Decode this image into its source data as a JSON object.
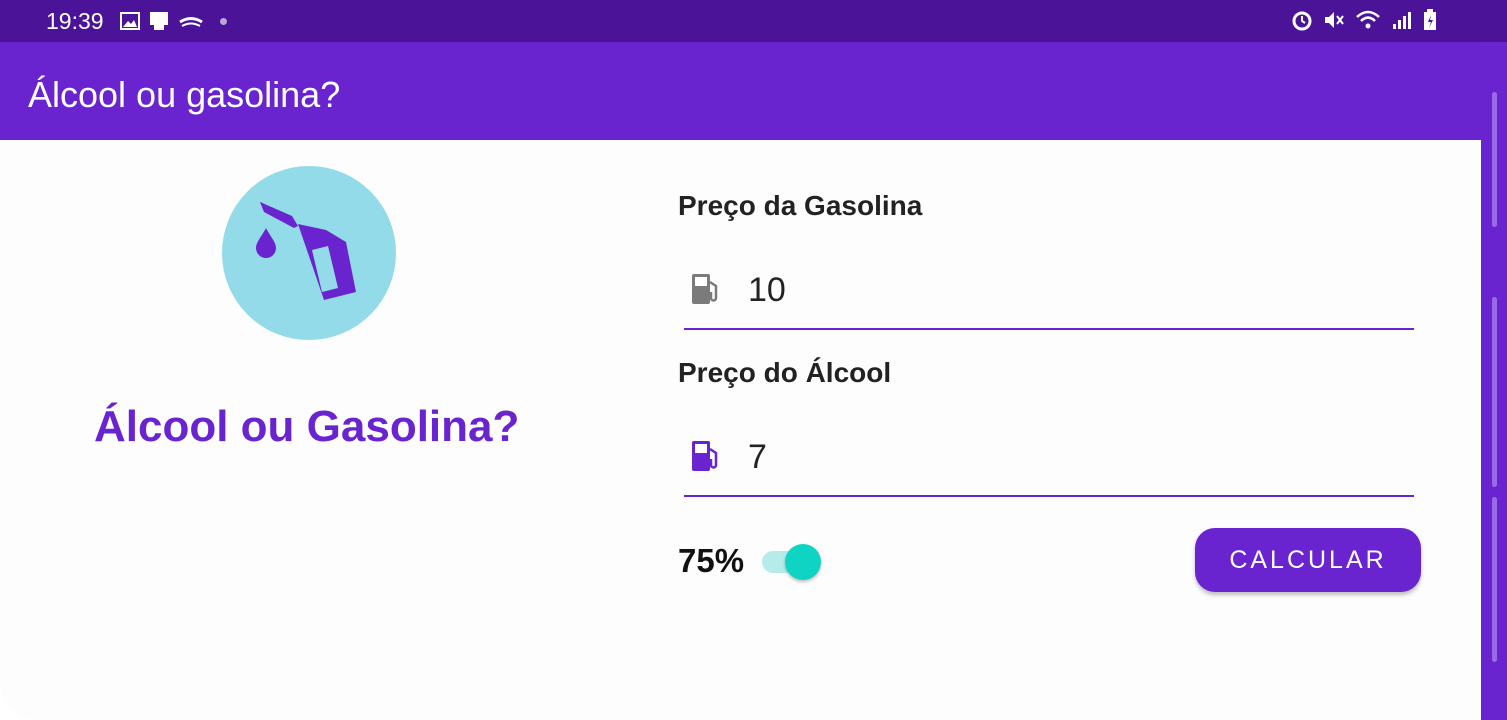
{
  "status_bar": {
    "time": "19:39",
    "left_icons": [
      "image-icon",
      "screen-cast-icon",
      "ifood-icon"
    ],
    "right_icons": [
      "alarm-icon",
      "mute-icon",
      "wifi-icon",
      "signal-icon",
      "battery-icon"
    ]
  },
  "app_bar": {
    "title": "Álcool ou gasolina?"
  },
  "hero": {
    "icon": "fuel-pump-icon",
    "title": "Álcool ou Gasolina?"
  },
  "form": {
    "gasolina": {
      "label": "Preço da Gasolina",
      "value": "10",
      "icon": "gas-station-icon"
    },
    "alcool": {
      "label": "Preço do Álcool",
      "value": "7",
      "icon": "gas-station-icon"
    },
    "percent_label": "75%",
    "switch_on": true,
    "calc_button": "CALCULAR"
  },
  "colors": {
    "primary": "#6a24cf",
    "status_bar": "#4b1397",
    "accent": "#0fd3c3",
    "logo_bg": "#93dbe8"
  }
}
